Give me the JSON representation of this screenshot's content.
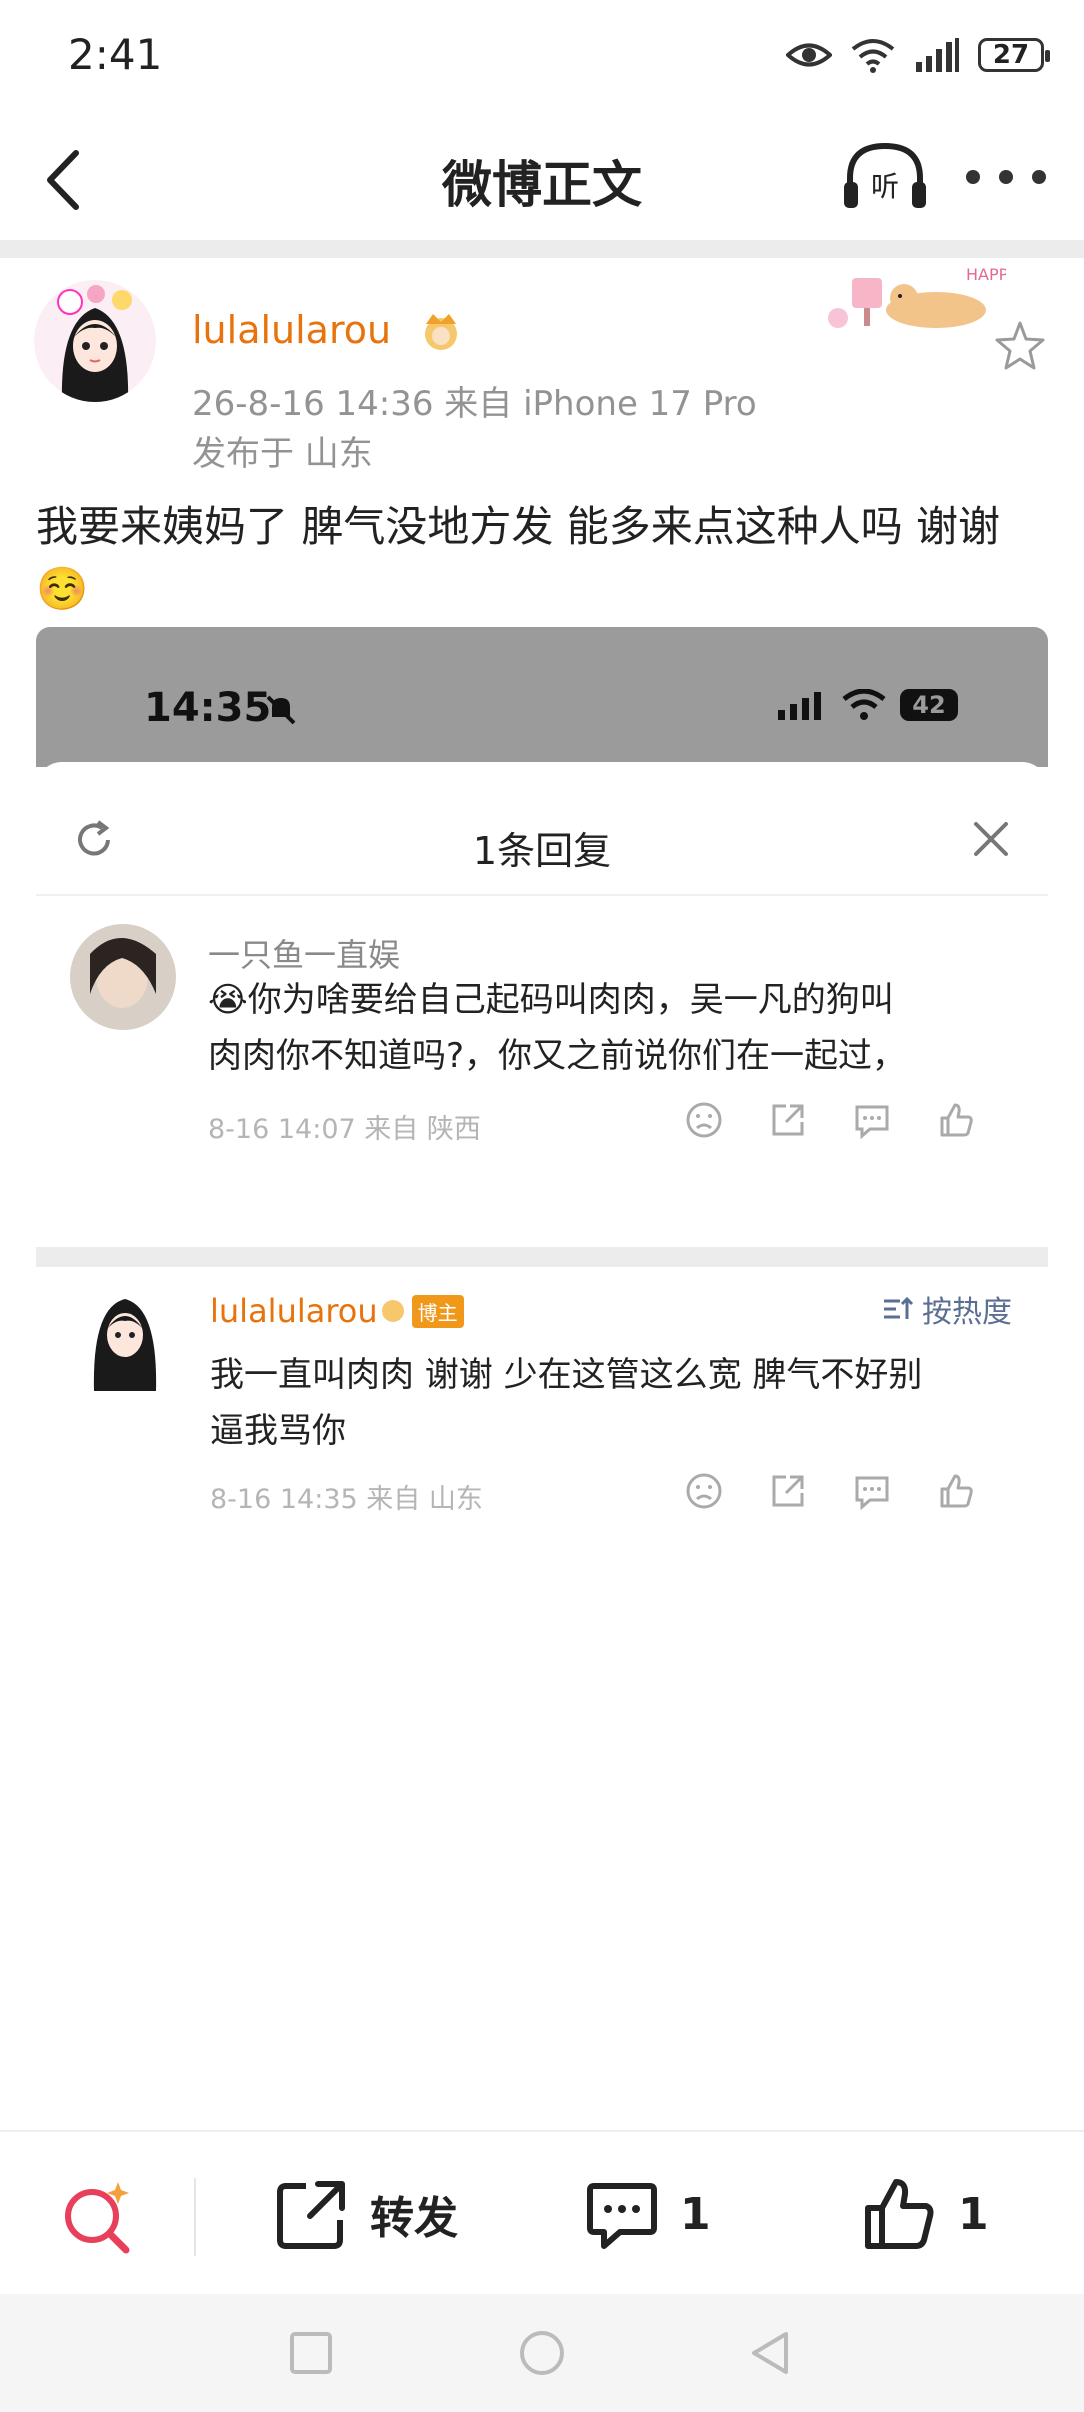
{
  "status_bar": {
    "time": "2:41",
    "battery": "27"
  },
  "nav": {
    "title": "微博正文",
    "listen_label": "听"
  },
  "post": {
    "username": "lulalularou",
    "meta": "26-8-16 14:36  来自 iPhone 17 Pro",
    "location": "发布于 山东",
    "text": "我要来姨妈了 脾气没地方发 能多来点这种人吗 谢谢☺️",
    "deco_text": "HAPPY"
  },
  "screenshot": {
    "time": "14:35",
    "battery": "42",
    "sheet_title": "1条回复",
    "sort_label": "按热度",
    "comment1": {
      "name": "一只鱼一直娱",
      "line1": "😭你为啥要给自己起码叫肉肉，吴一凡的狗叫",
      "line2": "肉肉你不知道吗?，你又之前说你们在一起过，",
      "meta": "8-16 14:07  来自 陕西"
    },
    "comment2": {
      "name": "lulalularou",
      "badge": "博主",
      "line1": "我一直叫肉肉 谢谢 少在这管这么宽 脾气不好别",
      "line2": "逼我骂你",
      "meta": "8-16 14:35  来自 山东"
    }
  },
  "bottom_bar": {
    "repost_label": "转发",
    "comment_count": "1",
    "like_count": "1"
  },
  "colors": {
    "username": "#e8730c",
    "meta": "#939393",
    "accent_search": "#e8405a"
  }
}
